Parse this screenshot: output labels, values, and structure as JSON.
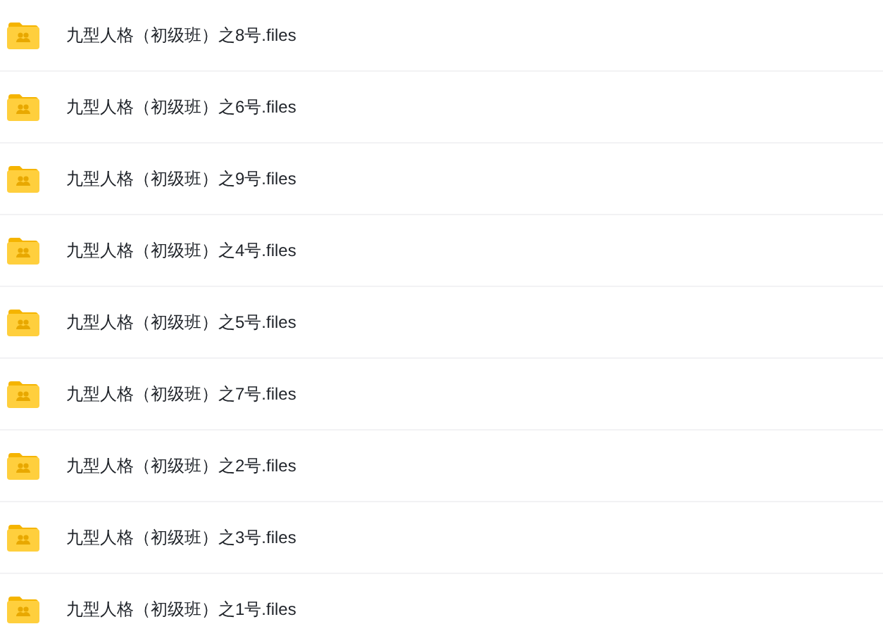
{
  "files": [
    {
      "name": "九型人格（初级班）之8号.files"
    },
    {
      "name": "九型人格（初级班）之6号.files"
    },
    {
      "name": "九型人格（初级班）之9号.files"
    },
    {
      "name": "九型人格（初级班）之4号.files"
    },
    {
      "name": "九型人格（初级班）之5号.files"
    },
    {
      "name": "九型人格（初级班）之7号.files"
    },
    {
      "name": "九型人格（初级班）之2号.files"
    },
    {
      "name": "九型人格（初级班）之3号.files"
    },
    {
      "name": "九型人格（初级班）之1号.files"
    }
  ]
}
